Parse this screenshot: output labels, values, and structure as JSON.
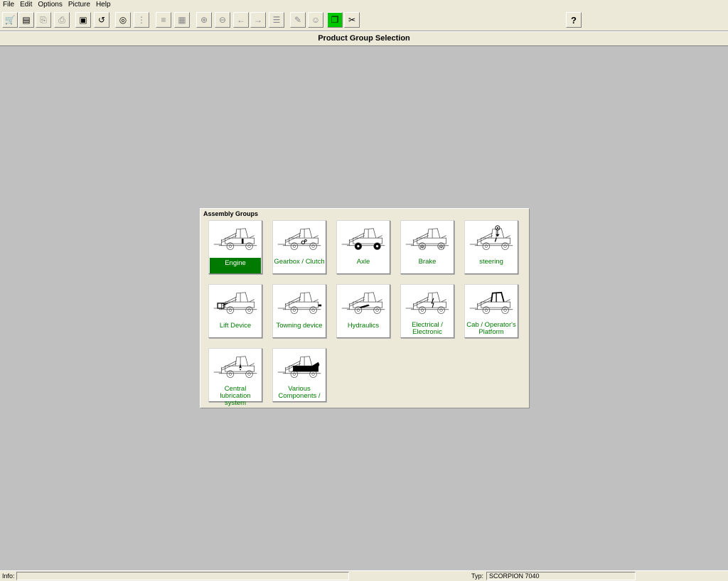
{
  "menu": [
    "File",
    "Edit",
    "Options",
    "Picture",
    "Help"
  ],
  "toolbar": {
    "buttons": [
      {
        "name": "cart-icon",
        "glyph": "🛒",
        "enabled": false
      },
      {
        "name": "list-icon",
        "glyph": "▤",
        "enabled": true
      },
      {
        "name": "import-icon",
        "glyph": "⎘",
        "enabled": false
      },
      {
        "name": "print-icon",
        "glyph": "⎙",
        "enabled": false
      },
      {
        "name": "export-icon",
        "glyph": "▣",
        "enabled": true
      },
      {
        "name": "undo-icon",
        "glyph": "↺",
        "enabled": true
      },
      {
        "name": "binoculars-icon",
        "glyph": "◎",
        "enabled": true
      },
      {
        "name": "tree-icon",
        "glyph": "⋮",
        "enabled": false
      },
      {
        "name": "document-icon",
        "glyph": "≡",
        "enabled": false
      },
      {
        "name": "image-icon",
        "glyph": "▦",
        "enabled": false
      },
      {
        "name": "zoom-in-icon",
        "glyph": "⊕",
        "enabled": false
      },
      {
        "name": "zoom-out-icon",
        "glyph": "⊖",
        "enabled": false
      },
      {
        "name": "arrow-left-icon",
        "glyph": "←",
        "enabled": false
      },
      {
        "name": "arrow-right-icon",
        "glyph": "→",
        "enabled": false
      },
      {
        "name": "page-list-icon",
        "glyph": "☰",
        "enabled": false
      },
      {
        "name": "wrench-icon",
        "glyph": "✎",
        "enabled": false
      },
      {
        "name": "smiley-icon",
        "glyph": "☺",
        "enabled": false
      },
      {
        "name": "copy-pages-icon",
        "glyph": "❐",
        "enabled": true,
        "active": true
      },
      {
        "name": "tools-icon",
        "glyph": "✂",
        "enabled": true
      },
      {
        "name": "help-icon",
        "glyph": "?",
        "enabled": true
      }
    ],
    "active_color": "#00c800"
  },
  "page_title": "Product Group Selection",
  "panel": {
    "title": "Assembly Groups",
    "groups": [
      {
        "label": "Engine",
        "selected": true,
        "highlight": "engine"
      },
      {
        "label": "Gearbox / Clutch",
        "selected": false,
        "highlight": "gearbox"
      },
      {
        "label": "Axle",
        "selected": false,
        "highlight": "axle"
      },
      {
        "label": "Brake",
        "selected": false,
        "highlight": "brake"
      },
      {
        "label": "steering",
        "selected": false,
        "highlight": "steering"
      },
      {
        "label": "Lift Device",
        "selected": false,
        "highlight": "lift"
      },
      {
        "label": "Towning device",
        "selected": false,
        "highlight": "towing"
      },
      {
        "label": "Hydraulics",
        "selected": false,
        "highlight": "hydraulics"
      },
      {
        "label": "Electrical / Electronic",
        "selected": false,
        "highlight": "electrical"
      },
      {
        "label": "Cab / Operator's Platform",
        "selected": false,
        "highlight": "cab"
      },
      {
        "label": "Central lubrication system",
        "selected": false,
        "highlight": "lubrication"
      },
      {
        "label": "Various Components /",
        "selected": false,
        "highlight": "various"
      }
    ],
    "label_color": "#007a00"
  },
  "status": {
    "info_label": "Info:",
    "info_value": "",
    "typ_label": "Typ:",
    "typ_value": "SCORPION 7040"
  }
}
